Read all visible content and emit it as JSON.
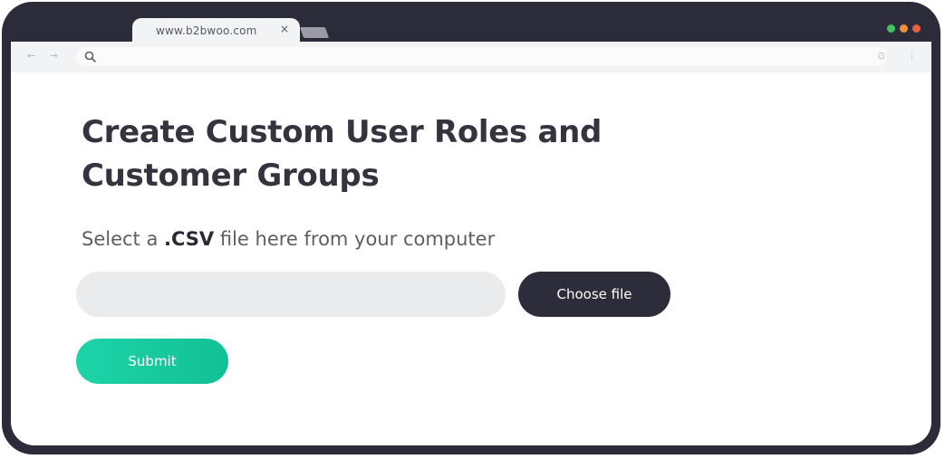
{
  "browser": {
    "tab_title": "www.b2bwoo.com",
    "tab_close": "×",
    "nav_arrows": "← →",
    "toolbar_icons": "⊙ ⋮",
    "window_dots": {
      "green": "#3fc45f",
      "orange": "#f0903c",
      "red": "#e9603e"
    }
  },
  "page": {
    "title": "Create Custom User Roles and Customer Groups",
    "instruction_prefix": "Select a ",
    "instruction_bold": ".CSV",
    "instruction_suffix": " file here from your computer",
    "file_input_value": "",
    "choose_file_label": "Choose file",
    "submit_label": "Submit"
  },
  "colors": {
    "frame": "#2c2b39",
    "accent": "#12c095",
    "dark_button": "#2d2c3a"
  }
}
